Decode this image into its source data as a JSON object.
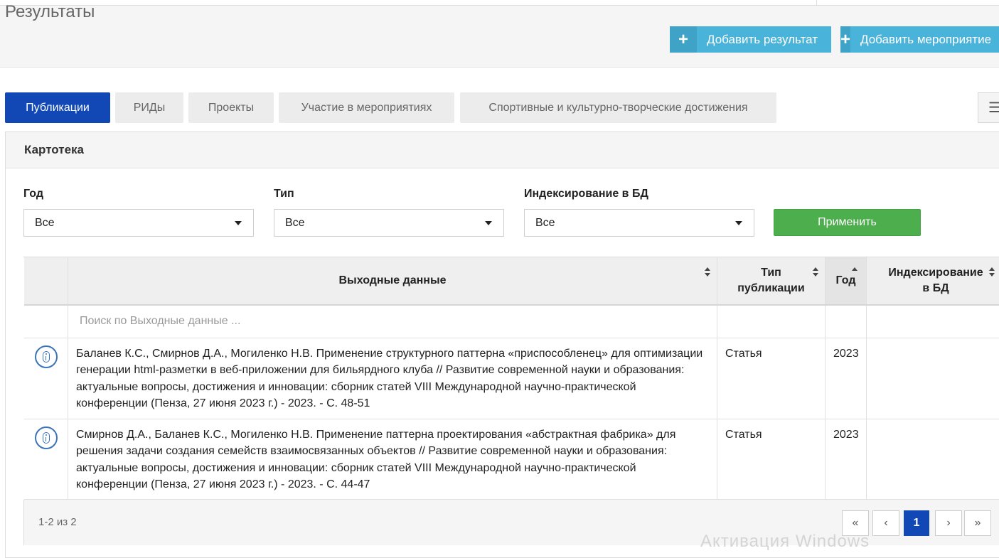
{
  "header": {
    "title": "Результаты",
    "add_result": "Добавить результат",
    "add_event": "Добавить мероприятие",
    "plus": "+"
  },
  "tabs": [
    {
      "label": "Публикации",
      "active": true
    },
    {
      "label": "РИДы",
      "active": false
    },
    {
      "label": "Проекты",
      "active": false
    },
    {
      "label": "Участие в мероприятиях",
      "active": false
    },
    {
      "label": "Спортивные и культурно-творческие достижения",
      "active": false
    }
  ],
  "menu_icon": "☰",
  "panel": {
    "title": "Картотека"
  },
  "filters": {
    "year": {
      "label": "Год",
      "value": "Все"
    },
    "type": {
      "label": "Тип",
      "value": "Все"
    },
    "index": {
      "label": "Индексирование в БД",
      "value": "Все"
    },
    "apply": "Применить"
  },
  "table": {
    "columns": {
      "output": "Выходные данные",
      "type_line1": "Тип",
      "type_line2": "публикации",
      "year": "Год",
      "index_line1": "Индексирование",
      "index_line2": "в БД"
    },
    "search_placeholder": "Поиск по Выходные данные ...",
    "rows": [
      {
        "output": "Баланев К.С., Смирнов Д.А., Могиленко Н.В. Применение структурного паттерна «приспособленец» для оптимизации генерации html-разметки в веб-приложении для бильярдного клуба // Развитие современной науки и образования: актуальные вопросы, достижения и инновации: сборник статей VIII Международной научно-практической конференции (Пенза, 27 июня 2023 г.) - 2023. - С. 48-51",
        "type": "Статья",
        "year": "2023",
        "index": ""
      },
      {
        "output": "Смирнов Д.А., Баланев К.С., Могиленко Н.В. Применение паттерна проектирования «абстрактная фабрика» для решения задачи создания семейств взаимосвязанных объектов // Развитие современной науки и образования: актуальные вопросы, достижения и инновации: сборник статей VIII Международной научно-практической конференции (Пенза, 27 июня 2023 г.) - 2023. - С. 44-47",
        "type": "Статья",
        "year": "2023",
        "index": ""
      }
    ]
  },
  "pagination": {
    "summary": "1-2 из 2",
    "first": "«",
    "prev": "‹",
    "current": "1",
    "next": "›",
    "last": "»"
  },
  "watermark": "Активация Windows"
}
